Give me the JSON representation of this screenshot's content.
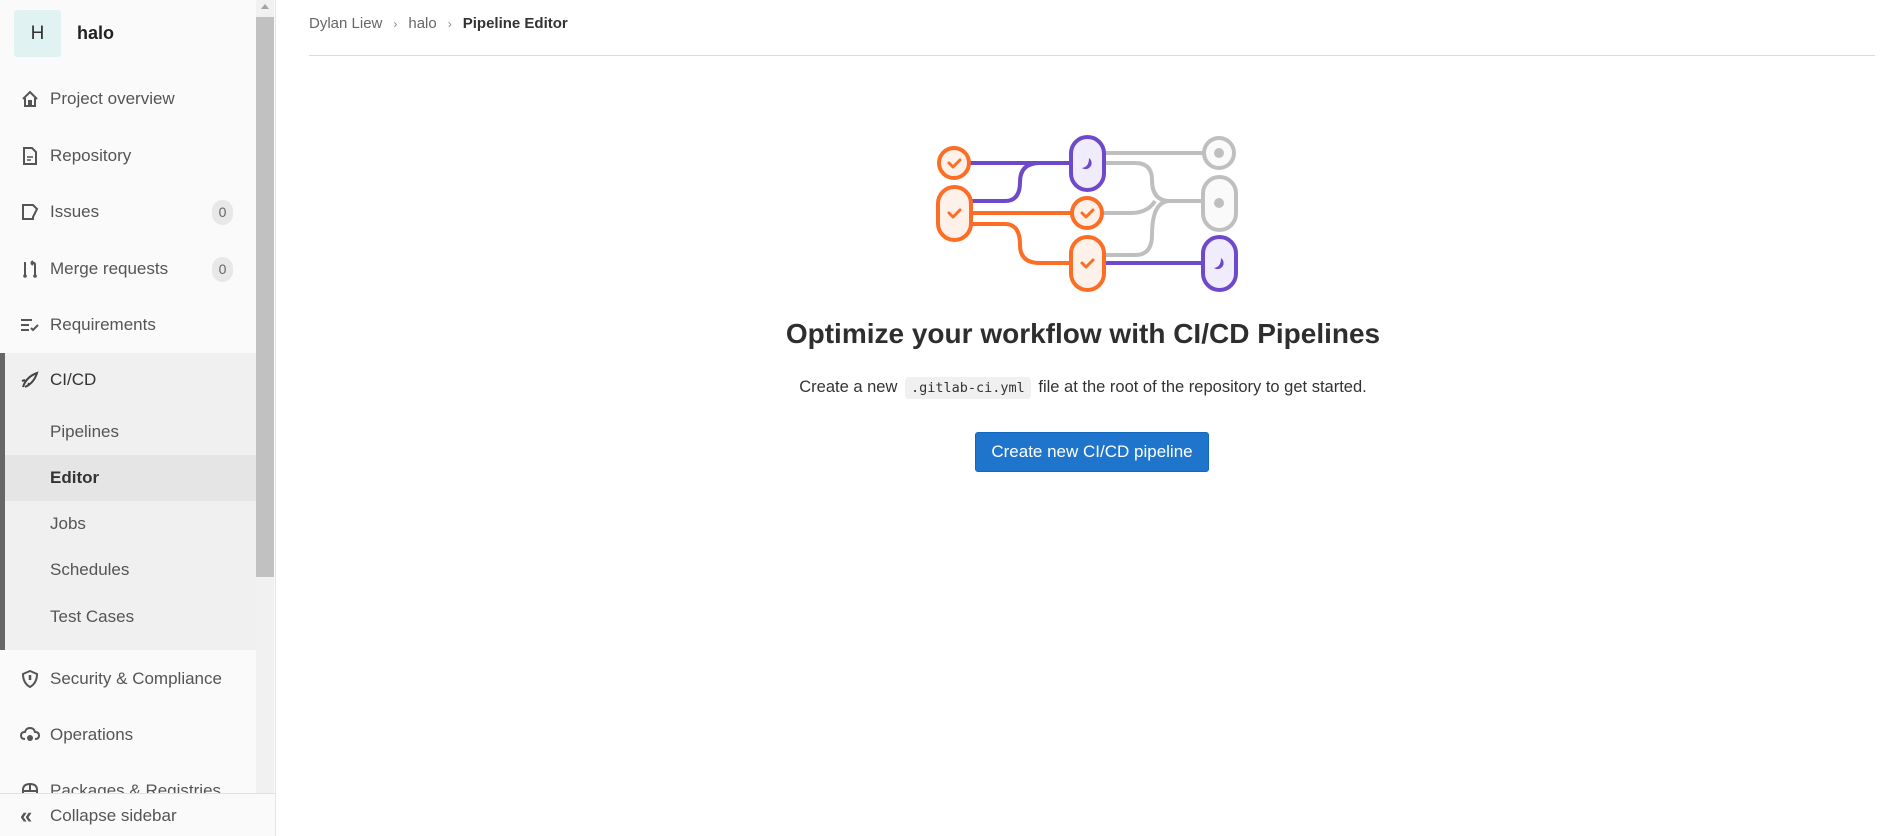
{
  "project": {
    "avatar_letter": "H",
    "name": "halo"
  },
  "sidebar": {
    "items": [
      {
        "label": "Project overview",
        "icon": "home-icon"
      },
      {
        "label": "Repository",
        "icon": "document-icon"
      },
      {
        "label": "Issues",
        "icon": "issues-icon",
        "badge": "0"
      },
      {
        "label": "Merge requests",
        "icon": "merge-request-icon",
        "badge": "0"
      },
      {
        "label": "Requirements",
        "icon": "requirements-icon"
      },
      {
        "label": "CI/CD",
        "icon": "rocket-icon"
      },
      {
        "label": "Security & Compliance",
        "icon": "shield-icon"
      },
      {
        "label": "Operations",
        "icon": "cloud-gear-icon"
      },
      {
        "label": "Packages & Registries",
        "icon": "package-icon"
      }
    ],
    "cicd_subitems": [
      {
        "label": "Pipelines"
      },
      {
        "label": "Editor",
        "active": true
      },
      {
        "label": "Jobs"
      },
      {
        "label": "Schedules"
      },
      {
        "label": "Test Cases"
      }
    ],
    "collapse_label": "Collapse sidebar"
  },
  "breadcrumb": [
    "Dylan Liew",
    "halo",
    "Pipeline Editor"
  ],
  "empty_state": {
    "title": "Optimize your workflow with CI/CD Pipelines",
    "description_before": "Create a new",
    "filename": ".gitlab-ci.yml",
    "description_after": "file at the root of the repository to get started.",
    "button_label": "Create new CI/CD pipeline"
  },
  "colors": {
    "primary": "#1f75cb",
    "orange": "#fc6d26",
    "purple": "#6e49cb",
    "gray": "#bfbfbf"
  }
}
